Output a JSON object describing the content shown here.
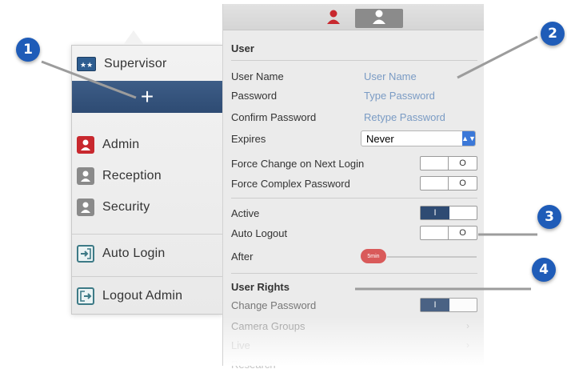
{
  "callouts": [
    "1",
    "2",
    "3",
    "4"
  ],
  "menu": {
    "supervisor_label": "Supervisor",
    "add_label": "+",
    "users": [
      "Admin",
      "Reception",
      "Security"
    ],
    "auto_login_label": "Auto Login",
    "logout_label": "Logout Admin"
  },
  "panel": {
    "user_section": "User",
    "user_name_label": "User Name",
    "user_name_placeholder": "User Name",
    "password_label": "Password",
    "password_placeholder": "Type Password",
    "confirm_label": "Confirm Password",
    "confirm_placeholder": "Retype Password",
    "expires_label": "Expires",
    "expires_value": "Never",
    "force_change_label": "Force Change on Next Login",
    "force_change_value": "O",
    "force_complex_label": "Force Complex Password",
    "force_complex_value": "O",
    "active_label": "Active",
    "active_value": "I",
    "auto_logout_label": "Auto Logout",
    "auto_logout_value": "O",
    "after_label": "After",
    "after_value": "5min",
    "rights_section": "User Rights",
    "change_password_label": "Change Password",
    "change_password_value": "I",
    "camera_groups_label": "Camera Groups",
    "live_label": "Live",
    "research_label": "Research"
  },
  "colors": {
    "callout": "#1f5cb8",
    "admin": "#c8282e",
    "accent": "#2e4b73",
    "link": "#7a9bc4"
  }
}
